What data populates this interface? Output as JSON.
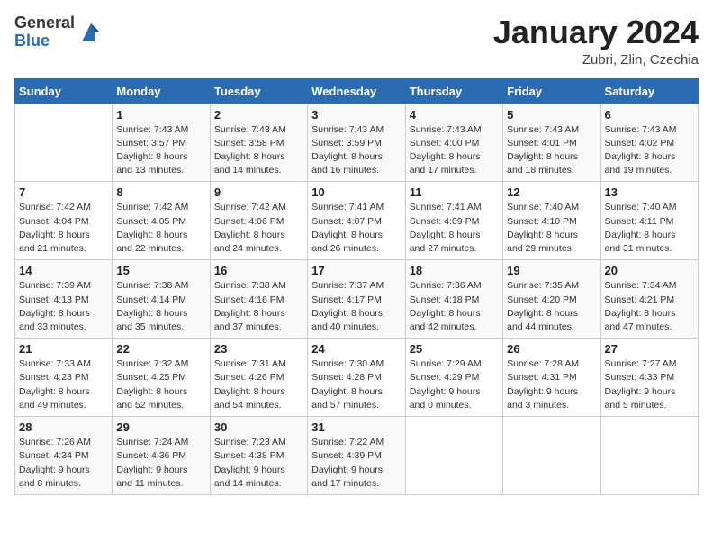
{
  "header": {
    "logo_general": "General",
    "logo_blue": "Blue",
    "month_title": "January 2024",
    "location": "Zubri, Zlin, Czechia"
  },
  "weekdays": [
    "Sunday",
    "Monday",
    "Tuesday",
    "Wednesday",
    "Thursday",
    "Friday",
    "Saturday"
  ],
  "weeks": [
    [
      {
        "day": "",
        "info": ""
      },
      {
        "day": "1",
        "info": "Sunrise: 7:43 AM\nSunset: 3:57 PM\nDaylight: 8 hours\nand 13 minutes."
      },
      {
        "day": "2",
        "info": "Sunrise: 7:43 AM\nSunset: 3:58 PM\nDaylight: 8 hours\nand 14 minutes."
      },
      {
        "day": "3",
        "info": "Sunrise: 7:43 AM\nSunset: 3:59 PM\nDaylight: 8 hours\nand 16 minutes."
      },
      {
        "day": "4",
        "info": "Sunrise: 7:43 AM\nSunset: 4:00 PM\nDaylight: 8 hours\nand 17 minutes."
      },
      {
        "day": "5",
        "info": "Sunrise: 7:43 AM\nSunset: 4:01 PM\nDaylight: 8 hours\nand 18 minutes."
      },
      {
        "day": "6",
        "info": "Sunrise: 7:43 AM\nSunset: 4:02 PM\nDaylight: 8 hours\nand 19 minutes."
      }
    ],
    [
      {
        "day": "7",
        "info": "Sunrise: 7:42 AM\nSunset: 4:04 PM\nDaylight: 8 hours\nand 21 minutes."
      },
      {
        "day": "8",
        "info": "Sunrise: 7:42 AM\nSunset: 4:05 PM\nDaylight: 8 hours\nand 22 minutes."
      },
      {
        "day": "9",
        "info": "Sunrise: 7:42 AM\nSunset: 4:06 PM\nDaylight: 8 hours\nand 24 minutes."
      },
      {
        "day": "10",
        "info": "Sunrise: 7:41 AM\nSunset: 4:07 PM\nDaylight: 8 hours\nand 26 minutes."
      },
      {
        "day": "11",
        "info": "Sunrise: 7:41 AM\nSunset: 4:09 PM\nDaylight: 8 hours\nand 27 minutes."
      },
      {
        "day": "12",
        "info": "Sunrise: 7:40 AM\nSunset: 4:10 PM\nDaylight: 8 hours\nand 29 minutes."
      },
      {
        "day": "13",
        "info": "Sunrise: 7:40 AM\nSunset: 4:11 PM\nDaylight: 8 hours\nand 31 minutes."
      }
    ],
    [
      {
        "day": "14",
        "info": "Sunrise: 7:39 AM\nSunset: 4:13 PM\nDaylight: 8 hours\nand 33 minutes."
      },
      {
        "day": "15",
        "info": "Sunrise: 7:38 AM\nSunset: 4:14 PM\nDaylight: 8 hours\nand 35 minutes."
      },
      {
        "day": "16",
        "info": "Sunrise: 7:38 AM\nSunset: 4:16 PM\nDaylight: 8 hours\nand 37 minutes."
      },
      {
        "day": "17",
        "info": "Sunrise: 7:37 AM\nSunset: 4:17 PM\nDaylight: 8 hours\nand 40 minutes."
      },
      {
        "day": "18",
        "info": "Sunrise: 7:36 AM\nSunset: 4:18 PM\nDaylight: 8 hours\nand 42 minutes."
      },
      {
        "day": "19",
        "info": "Sunrise: 7:35 AM\nSunset: 4:20 PM\nDaylight: 8 hours\nand 44 minutes."
      },
      {
        "day": "20",
        "info": "Sunrise: 7:34 AM\nSunset: 4:21 PM\nDaylight: 8 hours\nand 47 minutes."
      }
    ],
    [
      {
        "day": "21",
        "info": "Sunrise: 7:33 AM\nSunset: 4:23 PM\nDaylight: 8 hours\nand 49 minutes."
      },
      {
        "day": "22",
        "info": "Sunrise: 7:32 AM\nSunset: 4:25 PM\nDaylight: 8 hours\nand 52 minutes."
      },
      {
        "day": "23",
        "info": "Sunrise: 7:31 AM\nSunset: 4:26 PM\nDaylight: 8 hours\nand 54 minutes."
      },
      {
        "day": "24",
        "info": "Sunrise: 7:30 AM\nSunset: 4:28 PM\nDaylight: 8 hours\nand 57 minutes."
      },
      {
        "day": "25",
        "info": "Sunrise: 7:29 AM\nSunset: 4:29 PM\nDaylight: 9 hours\nand 0 minutes."
      },
      {
        "day": "26",
        "info": "Sunrise: 7:28 AM\nSunset: 4:31 PM\nDaylight: 9 hours\nand 3 minutes."
      },
      {
        "day": "27",
        "info": "Sunrise: 7:27 AM\nSunset: 4:33 PM\nDaylight: 9 hours\nand 5 minutes."
      }
    ],
    [
      {
        "day": "28",
        "info": "Sunrise: 7:26 AM\nSunset: 4:34 PM\nDaylight: 9 hours\nand 8 minutes."
      },
      {
        "day": "29",
        "info": "Sunrise: 7:24 AM\nSunset: 4:36 PM\nDaylight: 9 hours\nand 11 minutes."
      },
      {
        "day": "30",
        "info": "Sunrise: 7:23 AM\nSunset: 4:38 PM\nDaylight: 9 hours\nand 14 minutes."
      },
      {
        "day": "31",
        "info": "Sunrise: 7:22 AM\nSunset: 4:39 PM\nDaylight: 9 hours\nand 17 minutes."
      },
      {
        "day": "",
        "info": ""
      },
      {
        "day": "",
        "info": ""
      },
      {
        "day": "",
        "info": ""
      }
    ]
  ]
}
